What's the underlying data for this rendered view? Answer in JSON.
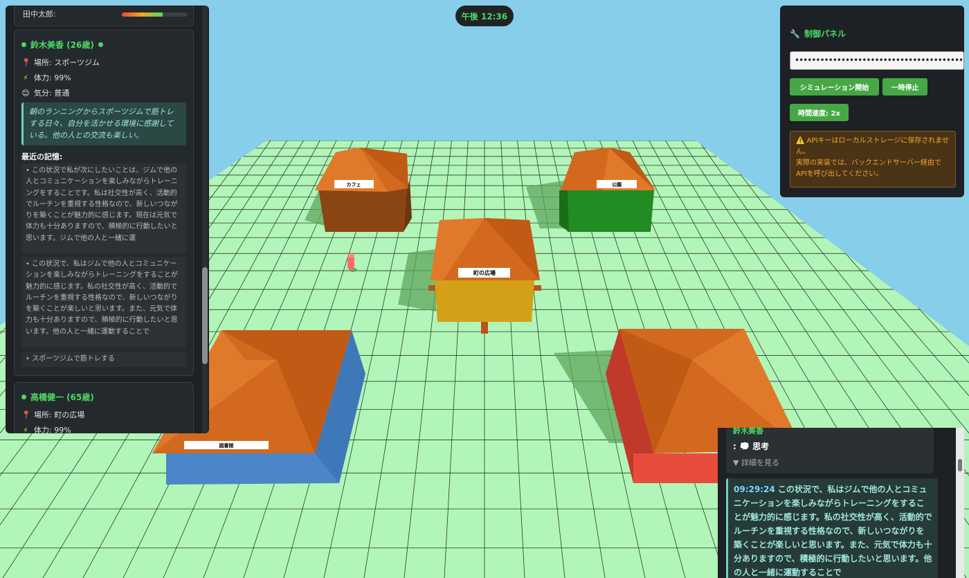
{
  "clock": "午後 12:36",
  "buildings": {
    "cafe": "カフェ",
    "park": "公園",
    "plaza": "町の広場",
    "library": "図書館"
  },
  "left_panel": {
    "prev_agent_name": "田中太郎:",
    "prev_energy_percent": 62,
    "agent1": {
      "name": "鈴木美香 (26歳)",
      "location": "場所: スポーツジム",
      "energy": "体力: 99%",
      "mood": "気分: 普通",
      "thought": "朝のランニングからスポーツジムで筋トレする日々、自分を活かせる環境に感謝している。他の人との交流も楽しい。",
      "memory_title": "最近の記憶:",
      "memories": [
        "• この状況で私が次にしたいことは、ジムで他の人とコミュニケーションを楽しみながらトレーニングをすることです。私は社交性が高く、活動的でルーチンを重視する性格なので、新しいつながりを築くことが魅力的に感じます。現在は元気で体力も十分ありますので、積極的に行動したいと思います。ジムで他の人と一緒に運",
        "• この状況で、私はジムで他の人とコミュニケーションを楽しみながらトレーニングをすることが魅力的に感じます。私の社交性が高く、活動的でルーチンを重視する性格なので、新しいつながりを築くことが楽しいと思います。また、元気で体力も十分ありますので、積極的に行動したいと思います。他の人と一緒に運動することで",
        "• スポーツジムで筋トレする"
      ]
    },
    "agent2": {
      "name": "高橋健一 (65歳)",
      "location": "場所: 町の広場",
      "energy": "体力: 99%"
    }
  },
  "control": {
    "title": "制御パネル",
    "api_key": "••••••••••••••••••••••••••••••••••••••••",
    "start_label": "シミュレーション開始",
    "pause_label": "一時停止",
    "speed_label": "時間速度: 2x",
    "warning_line1": "⚠️ APIキーはローカルストレージに保存されません。",
    "warning_line2": "実際の実装では、バックエンドサーバー経由でAPIを呼び出してください。"
  },
  "log": {
    "agent_name": "鈴木美香",
    "type": ": 💭 思考",
    "details_label": "▼ 詳細を見る",
    "entry_time": "09:29:24",
    "entry_text": "この状況で、私はジムで他の人とコミュニケーションを楽しみながらトレーニングをすることが魅力的に感じます。私の社交性が高く、活動的でルーチンを重視する性格なので、新しいつながりを築くことが楽しいと思います。また、元気で体力も十分ありますので、積極的に行動したいと思います。他の人と一緒に運動することで"
  }
}
